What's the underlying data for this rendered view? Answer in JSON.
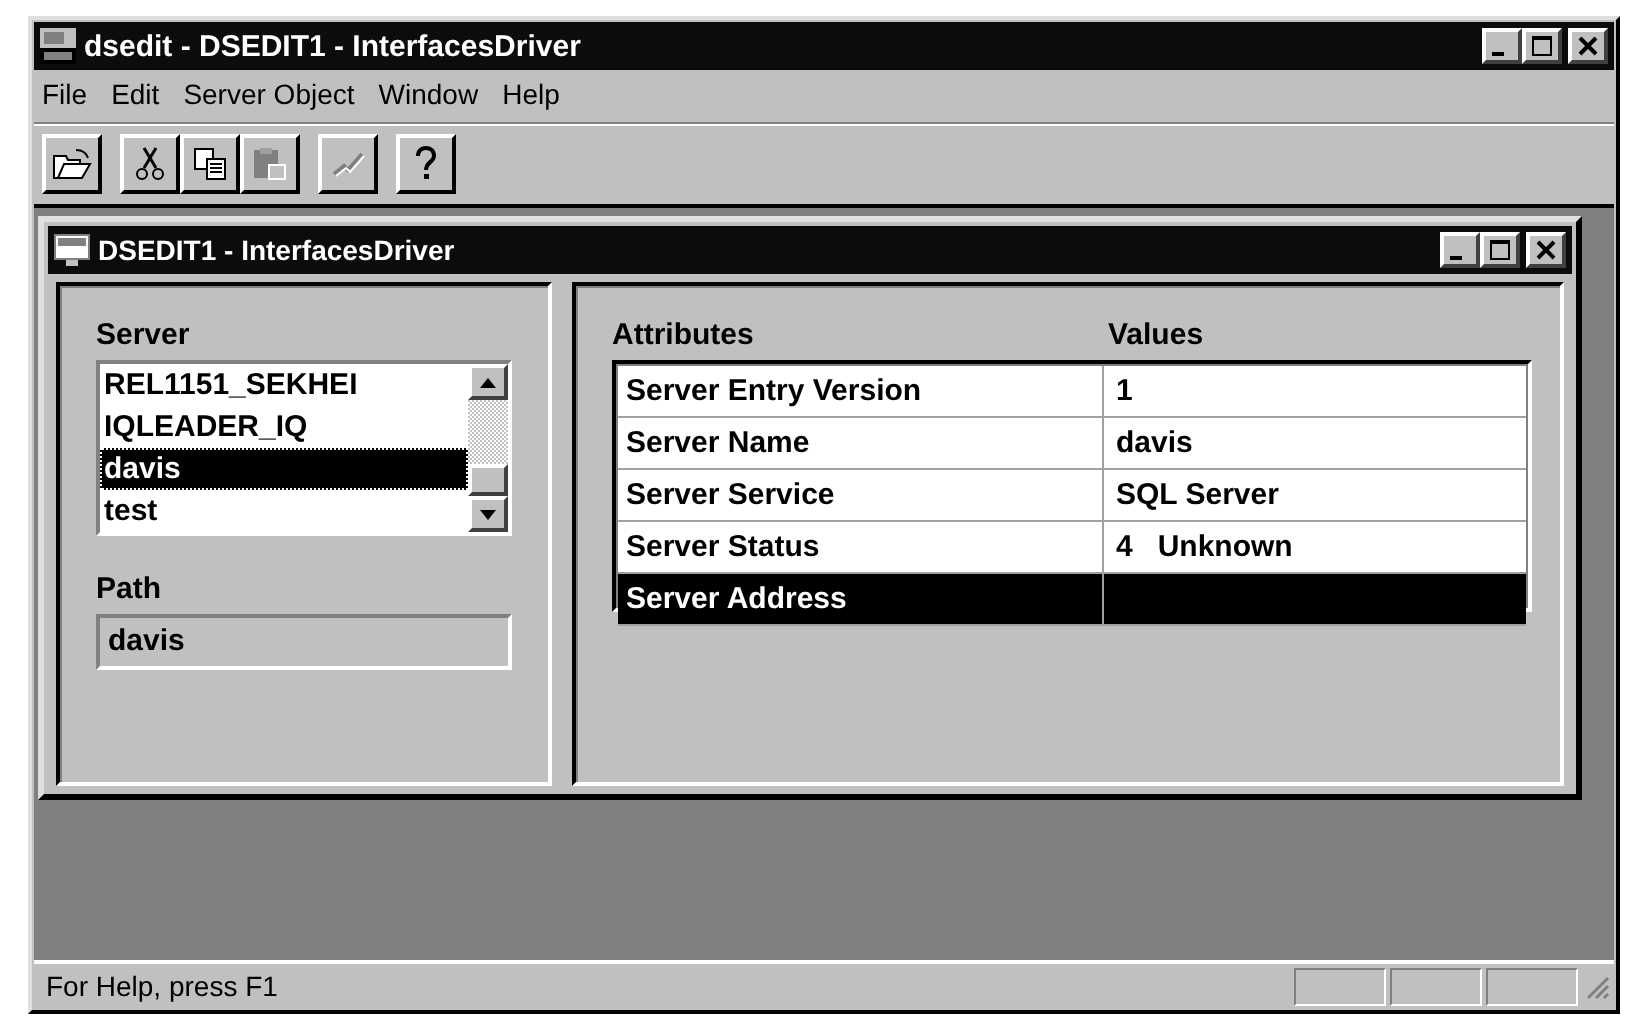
{
  "window": {
    "title": "dsedit - DSEDIT1 - InterfacesDriver"
  },
  "menu": [
    "File",
    "Edit",
    "Server Object",
    "Window",
    "Help"
  ],
  "toolbar": [
    {
      "kind": "open",
      "disabled": false
    },
    {
      "kind": "cut",
      "disabled": false
    },
    {
      "kind": "copy",
      "disabled": false
    },
    {
      "kind": "paste",
      "disabled": true
    },
    {
      "kind": "connect",
      "disabled": true
    },
    {
      "kind": "help",
      "disabled": false
    }
  ],
  "child_window": {
    "title": "DSEDIT1 - InterfacesDriver",
    "server_label": "Server",
    "servers": [
      {
        "name": "REL1151_SEKHEI",
        "selected": false
      },
      {
        "name": "IQLEADER_IQ",
        "selected": false
      },
      {
        "name": "davis",
        "selected": true
      },
      {
        "name": "test",
        "selected": false
      }
    ],
    "path_label": "Path",
    "path_value": "davis",
    "table": {
      "columns": [
        "Attributes",
        "Values"
      ],
      "rows": [
        {
          "attribute": "Server Entry Version",
          "value": "1",
          "selected": false
        },
        {
          "attribute": "Server Name",
          "value": "davis",
          "selected": false
        },
        {
          "attribute": "Server Service",
          "value": "SQL Server",
          "selected": false
        },
        {
          "attribute": "Server Status",
          "value": "4   Unknown",
          "selected": false
        },
        {
          "attribute": "Server Address",
          "selected": true
        }
      ]
    }
  },
  "status_bar": {
    "text": "For Help, press F1"
  }
}
